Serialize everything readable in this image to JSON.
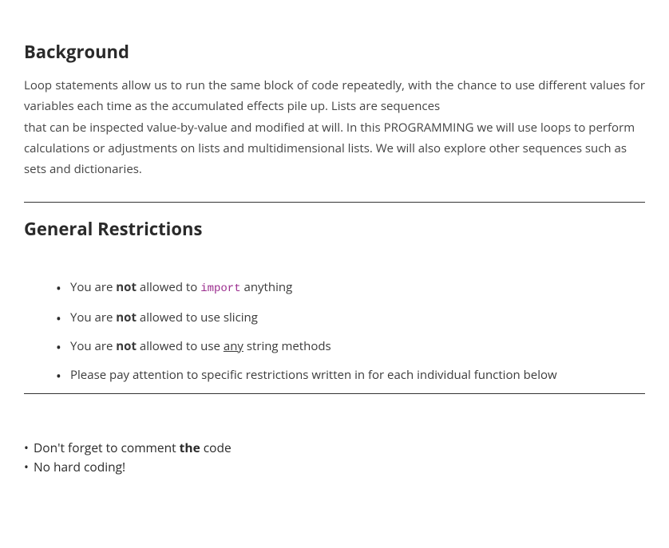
{
  "background": {
    "heading": "Background",
    "text_line1": "Loop statements allow us to run the same block of code repeatedly, with the chance to use different values for variables each time as the accumulated effects pile up. Lists are sequences",
    "text_line2": "that can be inspected value-by-value and modified at will. In this PROGRAMMING we will use loops to perform calculations or adjustments on lists and multidimensional lists. We will also explore other sequences such as sets and dictionaries."
  },
  "restrictions": {
    "heading": "General Restrictions",
    "items": {
      "r1_pre": "You are ",
      "r1_bold": "not",
      "r1_mid": " allowed to ",
      "r1_code": "import",
      "r1_post": " anything",
      "r2_pre": "You are ",
      "r2_bold": "not",
      "r2_post": " allowed to use slicing",
      "r3_pre": "You are ",
      "r3_bold": "not",
      "r3_mid": " allowed to use ",
      "r3_underline": "any",
      "r3_post": " string methods",
      "r4": "Please pay attention to specific restrictions written in for each individual function below"
    }
  },
  "notes": {
    "n1_pre": "Don't forget to comment ",
    "n1_bold": "the",
    "n1_post": " code",
    "n2": "No hard coding!"
  }
}
